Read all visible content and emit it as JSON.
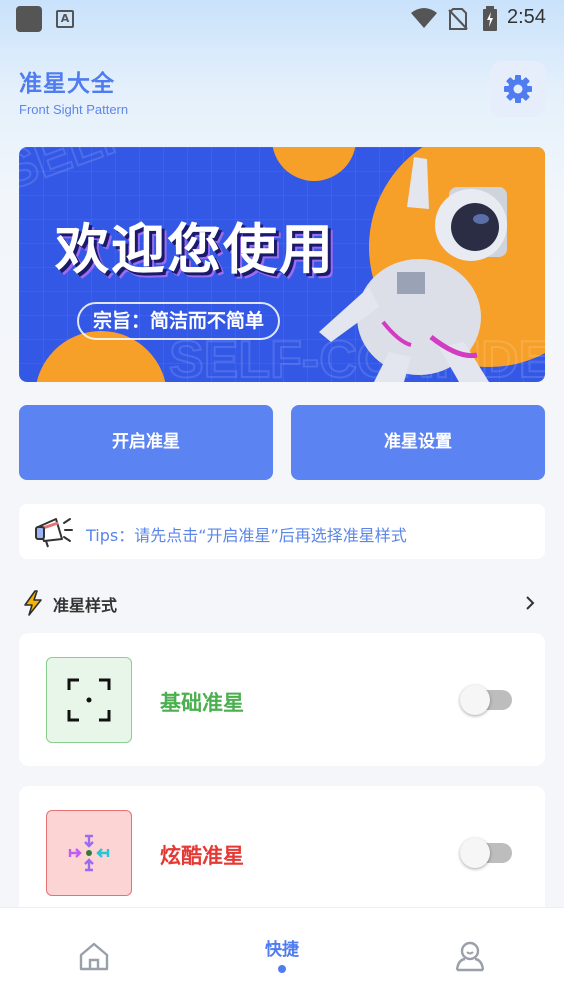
{
  "status_bar": {
    "time": "2:54",
    "icons": [
      "app-icon",
      "a-icon",
      "wifi-icon",
      "no-sim-icon",
      "battery-charging-icon"
    ]
  },
  "header": {
    "title": "准星大全",
    "subtitle": "Front Sight Pattern",
    "settings_icon": "gear-icon"
  },
  "banner": {
    "title": "欢迎您使用",
    "tagline": "宗旨：简洁而不简单",
    "background_text": "SELF-CONFIDENCE",
    "image": "astronaut"
  },
  "actions": {
    "open_label": "开启准星",
    "settings_label": "准星设置"
  },
  "tips": {
    "text": "Tips：请先点击“开启准星”后再选择准星样式"
  },
  "section": {
    "title": "准星样式",
    "chevron_icon": "chevron-right-icon"
  },
  "crosshairs": [
    {
      "label": "基础准星",
      "color": "#4caf50",
      "enabled": false
    },
    {
      "label": "炫酷准星",
      "color": "#e53935",
      "enabled": false
    }
  ],
  "bottom_nav": {
    "items": [
      {
        "icon": "home-icon",
        "label": ""
      },
      {
        "icon": "",
        "label": "快捷",
        "active": true
      },
      {
        "icon": "profile-icon",
        "label": ""
      }
    ]
  },
  "colors": {
    "accent": "#4f7cf0",
    "button": "#5b83f2",
    "banner_bg": "#3358e6",
    "banner_orange": "#f6a02a"
  }
}
